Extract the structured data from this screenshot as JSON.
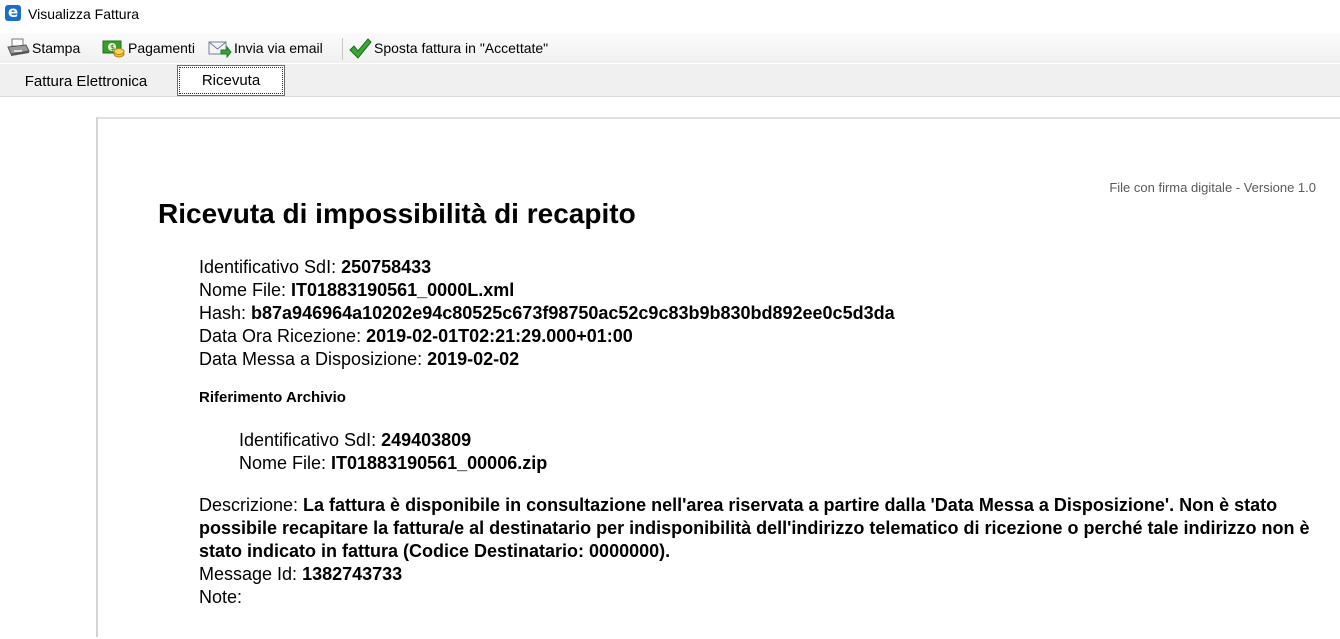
{
  "window": {
    "title": "Visualizza Fattura"
  },
  "toolbar": {
    "stampa": "Stampa",
    "pagamenti": "Pagamenti",
    "invia_email": "Invia via email",
    "sposta": "Sposta fattura in \"Accettate\""
  },
  "tabs": {
    "fattura_elettronica": "Fattura Elettronica",
    "ricevuta": "Ricevuta",
    "active": "Ricevuta"
  },
  "receipt": {
    "versione": "File con firma digitale - Versione 1.0",
    "title": "Ricevuta di impossibilità di recapito",
    "identificativo_label": "Identificativo SdI: ",
    "identificativo": "250758433",
    "nome_file_label": "Nome File: ",
    "nome_file": "IT01883190561_0000L.xml",
    "hash_label": "Hash: ",
    "hash": "b87a946964a10202e94c80525c673f98750ac52c9c83b9b830bd892ee0c5d3da",
    "data_ricezione_label": "Data Ora Ricezione: ",
    "data_ricezione": "2019-02-01T02:21:29.000+01:00",
    "data_disposizione_label": "Data Messa a Disposizione: ",
    "data_disposizione": "2019-02-02",
    "riferimento_archivio": "Riferimento Archivio",
    "archivio": {
      "identificativo_label": "Identificativo SdI: ",
      "identificativo": "249403809",
      "nome_file_label": "Nome File: ",
      "nome_file": "IT01883190561_00006.zip"
    },
    "descrizione_label": "Descrizione: ",
    "descrizione": "La fattura è disponibile in consultazione nell'area riservata a partire dalla 'Data Messa a Disposizione'. Non è stato possibile recapitare la fattura/e al destinatario per indisponibilità dell'indirizzo telematico di ricezione o perché tale indirizzo non è stato indicato in fattura (Codice Destinatario: 0000000).",
    "message_id_label": "Message Id: ",
    "message_id": "1382743733",
    "note_label": "Note:",
    "note": ""
  }
}
